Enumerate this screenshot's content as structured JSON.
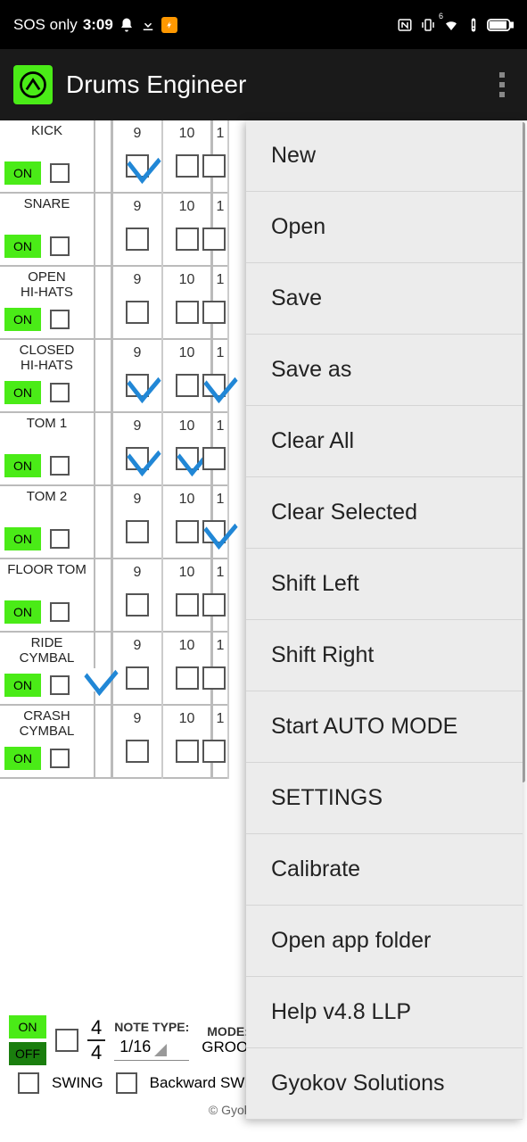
{
  "status": {
    "network": "SOS only",
    "time": "3:09"
  },
  "app": {
    "title": "Drums Engineer"
  },
  "columns": [
    "9",
    "10",
    "1"
  ],
  "tracks": [
    {
      "name": "KICK",
      "btn": "ON",
      "cells": [
        {
          "n": "9",
          "c": true
        },
        {
          "n": "10",
          "c": false
        },
        {
          "n": "1",
          "c": false
        }
      ]
    },
    {
      "name": "SNARE",
      "btn": "ON",
      "cells": [
        {
          "n": "9",
          "c": false
        },
        {
          "n": "10",
          "c": false
        },
        {
          "n": "1",
          "c": false
        }
      ]
    },
    {
      "name": "OPEN\nHI-HATS",
      "btn": "ON",
      "cells": [
        {
          "n": "9",
          "c": false
        },
        {
          "n": "10",
          "c": false
        },
        {
          "n": "1",
          "c": false
        }
      ]
    },
    {
      "name": "CLOSED\nHI-HATS",
      "btn": "ON",
      "cells": [
        {
          "n": "9",
          "c": true
        },
        {
          "n": "10",
          "c": false
        },
        {
          "n": "1",
          "c": true
        }
      ]
    },
    {
      "name": "TOM 1",
      "btn": "ON",
      "cells": [
        {
          "n": "9",
          "c": true
        },
        {
          "n": "10",
          "c": true
        },
        {
          "n": "1",
          "c": false
        }
      ]
    },
    {
      "name": "TOM 2",
      "btn": "ON",
      "cells": [
        {
          "n": "9",
          "c": false
        },
        {
          "n": "10",
          "c": false
        },
        {
          "n": "1",
          "c": true
        }
      ]
    },
    {
      "name": "FLOOR TOM",
      "btn": "ON",
      "cells": [
        {
          "n": "9",
          "c": false
        },
        {
          "n": "10",
          "c": false
        },
        {
          "n": "1",
          "c": false
        }
      ]
    },
    {
      "name": "RIDE\nCYMBAL",
      "btn": "ON",
      "cells": [
        {
          "n": "9",
          "c": false
        },
        {
          "n": "10",
          "c": false
        },
        {
          "n": "1",
          "c": false
        }
      ],
      "hasLeftMark": true
    },
    {
      "name": "CRASH\nCYMBAL",
      "btn": "ON",
      "cells": [
        {
          "n": "9",
          "c": false
        },
        {
          "n": "10",
          "c": false
        },
        {
          "n": "1",
          "c": false
        }
      ]
    }
  ],
  "bottom": {
    "on": "ON",
    "off": "OFF",
    "timeTop": "4",
    "timeBot": "4",
    "noteTypeLabel": "NOTE TYPE:",
    "noteTypeValue": "1/16",
    "modeLabel": "MODE:",
    "modeValue": "GROOVE",
    "swing": "SWING",
    "backwardSwing": "Backward SWI",
    "copyright": "© Gyokov Solutions"
  },
  "menu": [
    "New",
    "Open",
    "Save",
    "Save as",
    "Clear All",
    "Clear Selected",
    "Shift Left",
    "Shift Right",
    "Start AUTO MODE",
    "SETTINGS",
    "Calibrate",
    "Open app folder",
    "Help v4.8 LLP",
    "Gyokov Solutions"
  ]
}
